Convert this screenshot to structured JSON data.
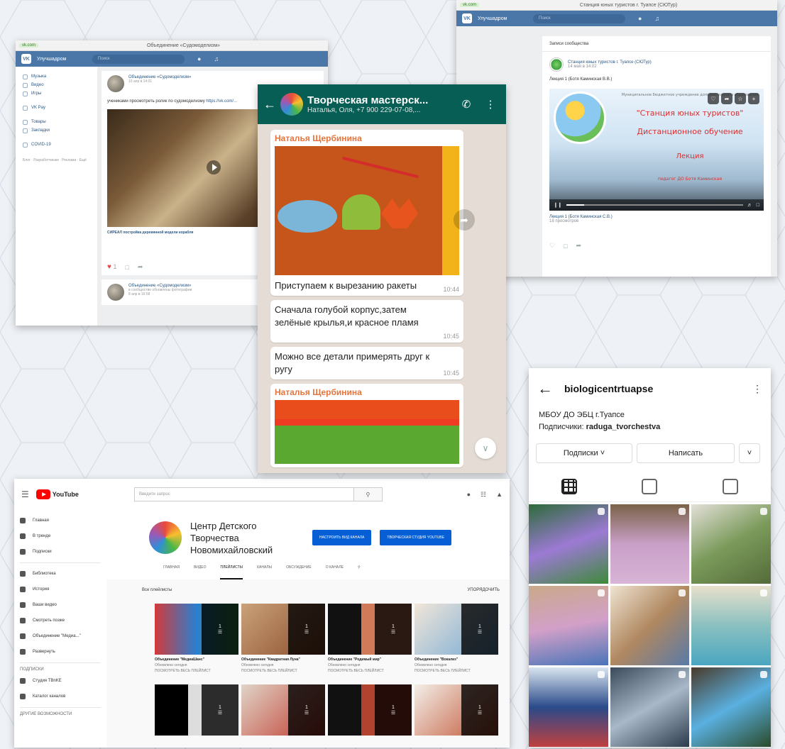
{
  "colors": {
    "vk_blue": "#4a76a8",
    "whatsapp_green": "#075e54",
    "youtube_red": "#ff0000",
    "youtube_blue": "#065fd4",
    "background": "#eef1f5"
  },
  "vk_left": {
    "url": "vk.com",
    "window_title": "Объединение «Судомоделизм»",
    "brand": "Улучшадром",
    "search_placeholder": "Поиск",
    "sidebar": [
      {
        "label": "Музыка",
        "icon": "music-icon"
      },
      {
        "label": "Видео",
        "icon": "video-icon"
      },
      {
        "label": "Игры",
        "icon": "games-icon"
      },
      {
        "label": "VK Pay",
        "icon": "pay-icon"
      },
      {
        "label": "Товары",
        "icon": "goods-icon"
      },
      {
        "label": "Закладки",
        "icon": "bookmark-icon"
      },
      {
        "label": "COVID-19",
        "icon": "covid-icon"
      }
    ],
    "sidebar_footer": "Блог · Разработчикам · Реклама · Ещё",
    "post1": {
      "author": "Объединение «Судомоделизм»",
      "date": "10 апр в 14:01",
      "text": "учениками просмотреть ролик по судомоделизму",
      "link": "https://vk.com/...",
      "video_caption": "СИРЕАЛ постройка деревянной модели корабля",
      "likes": "1"
    },
    "post2": {
      "author": "Объединение «Судомоделизм»",
      "subtitle": "в сообществе обновлены фотографии",
      "date": "8 апр в 16:58"
    }
  },
  "vk_right": {
    "url": "vk.com",
    "window_title": "Станция юных туристов г. Туапсе (СЮТур)",
    "brand": "Улучшадром",
    "search_placeholder": "Поиск",
    "tab": "Записи сообщества",
    "post": {
      "author": "Станция юных туристов г. Туапсе (СЮТур)",
      "date": "14 мая в 14:02",
      "title": "Лекция 1 (Ботя Каминская В.В.)",
      "media_lines": [
        "Муниципальное бюджетное учреждение дополнительного образования",
        "\"Станция юных туристов\"",
        "Дистанционное обучение",
        "Лекция",
        "педагог ДО Ботя Каминская"
      ],
      "caption": "Лекция 1 (Ботя Каминская С.В.)",
      "views": "18 просмотров"
    }
  },
  "whatsapp": {
    "title": "Творческая мастерск...",
    "subtitle": "Наталья, Оля, +7 900 229-07-08,...",
    "messages": [
      {
        "sender": "Наталья Щербинина",
        "text": "Приступаем к вырезанию ракеты",
        "time": "10:44"
      },
      {
        "sender": "",
        "text": "Сначала голубой корпус,затем зелёные крылья,и красное пламя",
        "time": "10:45"
      },
      {
        "sender": "",
        "text": "Можно все детали примерять друг к ругу",
        "time": "10:45"
      },
      {
        "sender": "Наталья Щербинина",
        "text": "",
        "time": ""
      }
    ]
  },
  "instagram": {
    "username": "biologicentrtuapse",
    "bio_line1": "МБОУ ДО ЭБЦ г.Туапсе",
    "bio_prefix": "Подписчики:",
    "bio_follower": "raduga_tvorchestva",
    "btn_following": "Подписки ˅",
    "btn_message": "Написать",
    "btn_more": "˅"
  },
  "youtube": {
    "logo_text": "YouTube",
    "search_placeholder": "Введите запрос",
    "sidebar": [
      {
        "label": "Главная"
      },
      {
        "label": "В тренде"
      },
      {
        "label": "Подписки"
      },
      {
        "label": "Библиотека"
      },
      {
        "label": "История"
      },
      {
        "label": "Ваши видео"
      },
      {
        "label": "Смотреть позже"
      },
      {
        "label": "Объединение \"Медиа...\""
      },
      {
        "label": "Развернуть"
      }
    ],
    "subs_header": "ПОДПИСКИ",
    "subs": [
      {
        "label": "Студия TBnKE"
      },
      {
        "label": "Каталог каналов"
      }
    ],
    "other_header": "ДРУГИЕ ВОЗМОЖНОСТИ",
    "channel_name": "Центр Детского Творчества Новомихайловский",
    "btn_customize": "НАСТРОИТЬ ВИД КАНАЛА",
    "btn_studio": "ТВОРЧЕСКАЯ СТУДИЯ YOUTUBE",
    "tabs": [
      "ГЛАВНАЯ",
      "ВИДЕО",
      "ПЛЕЙЛИСТЫ",
      "КАНАЛЫ",
      "ОБСУЖДЕНИЕ",
      "О КАНАЛЕ"
    ],
    "section_title": "Все плейлисты",
    "sort_label": "УПОРЯДОЧИТЬ",
    "playlists": [
      {
        "title": "Объединение \"МедиаШанс\"",
        "sub": "Обновлено сегодня",
        "link": "ПОСМОТРЕТЬ ВЕСЬ ПЛЕЙЛИСТ",
        "count": "1"
      },
      {
        "title": "Объединение \"Квадратная Луна\"",
        "sub": "Обновлено сегодня",
        "link": "ПОСМОТРЕТЬ ВЕСЬ ПЛЕЙЛИСТ",
        "count": "1"
      },
      {
        "title": "Объединение \"Родимый мир\"",
        "sub": "Обновлено сегодня",
        "link": "ПОСМОТРЕТЬ ВЕСЬ ПЛЕЙЛИСТ",
        "count": "1"
      },
      {
        "title": "Объединение \"Вокализ\"",
        "sub": "Обновлено сегодня",
        "link": "ПОСМОТРЕТЬ ВЕСЬ ПЛЕЙЛИСТ",
        "count": "1"
      }
    ],
    "row2_counts": [
      "1",
      "1",
      "1",
      "1"
    ]
  }
}
